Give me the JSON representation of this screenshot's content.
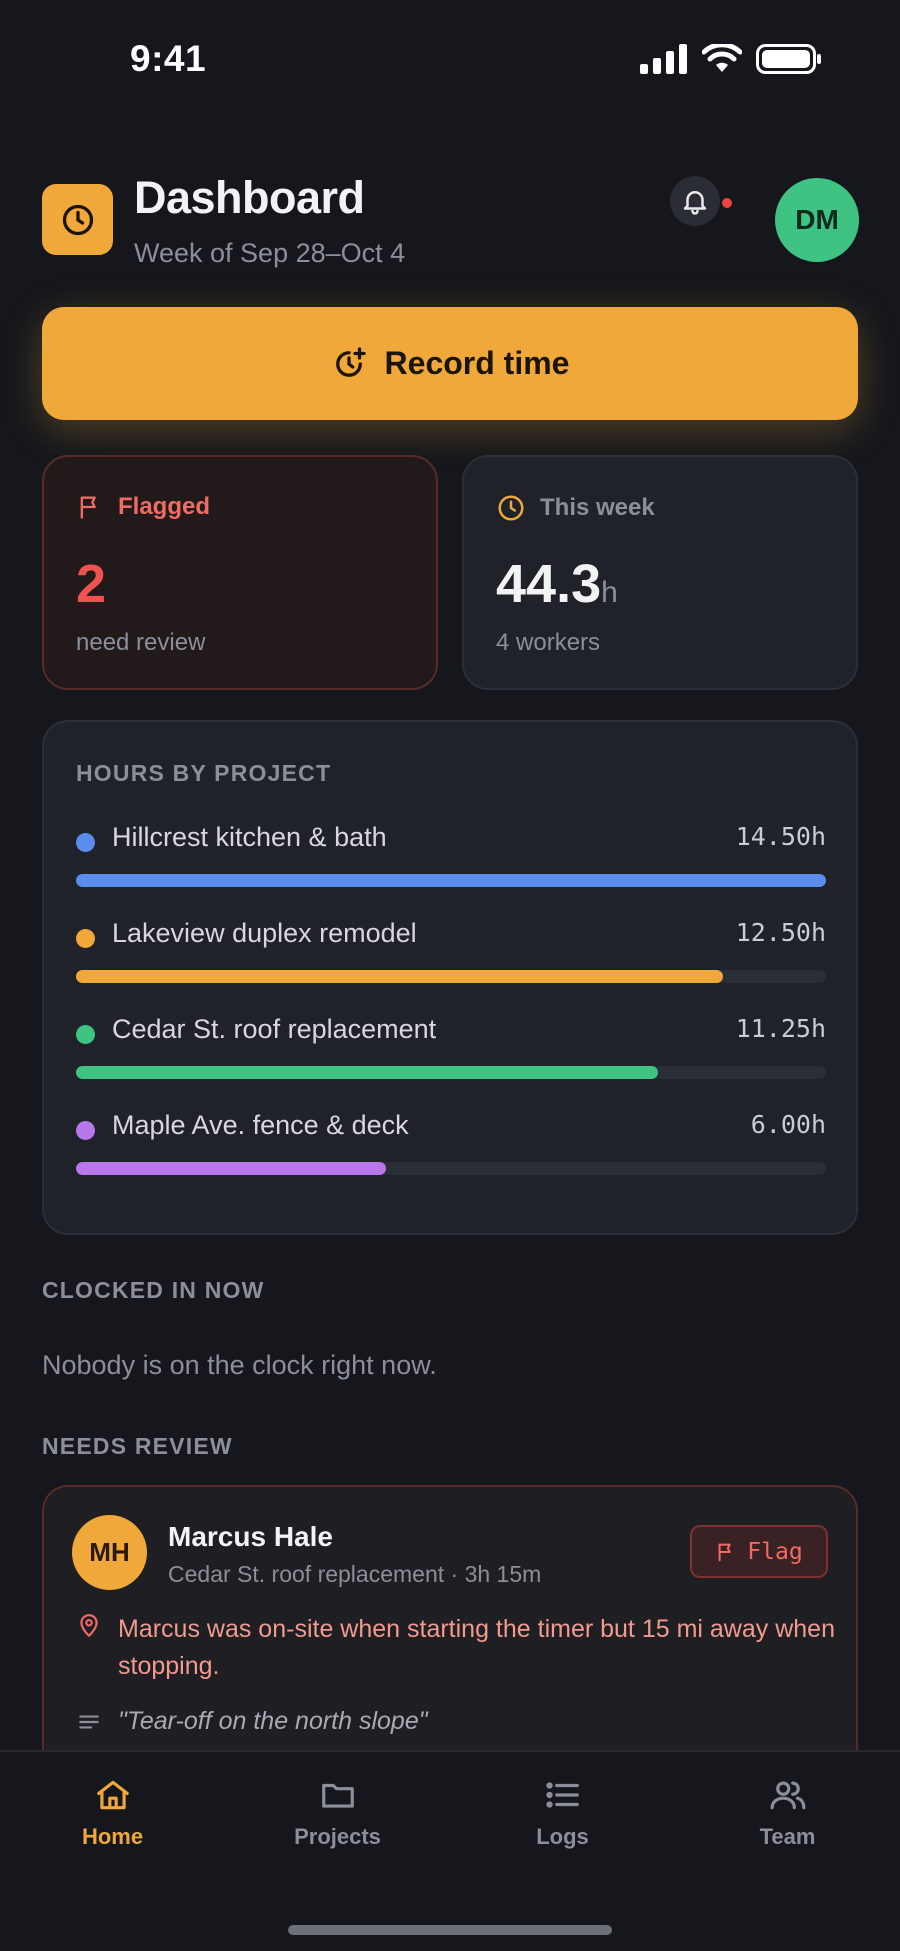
{
  "status_bar": {
    "time": "9:41"
  },
  "header": {
    "title": "Dashboard",
    "subtitle": "Week of Sep 28–Oct 4",
    "avatar_initials": "DM"
  },
  "record_button": {
    "label": "Record time"
  },
  "flagged_card": {
    "label": "Flagged",
    "value": "2",
    "note": "need review"
  },
  "week_card": {
    "label": "This week",
    "value": "44.3",
    "unit": "h",
    "note": "4 workers"
  },
  "hours_by_project": {
    "title": "HOURS BY PROJECT",
    "projects": [
      {
        "name": "Hillcrest kitchen & bath",
        "hours": "14.50h",
        "value": 14.5,
        "color": "#5b8def"
      },
      {
        "name": "Lakeview duplex remodel",
        "hours": "12.50h",
        "value": 12.5,
        "color": "#f0a83a"
      },
      {
        "name": "Cedar St. roof replacement",
        "hours": "11.25h",
        "value": 11.25,
        "color": "#3fc383"
      },
      {
        "name": "Maple Ave. fence & deck",
        "hours": "6.00h",
        "value": 6.0,
        "color": "#b877ea"
      }
    ]
  },
  "clocked_in": {
    "title": "CLOCKED IN NOW",
    "empty_text": "Nobody is on the clock right now."
  },
  "needs_review": {
    "title": "NEEDS REVIEW",
    "item": {
      "initials": "MH",
      "name": "Marcus Hale",
      "meta": "Cedar St. roof replacement · 3h 15m",
      "flag_label": "Flag",
      "warning": "Marcus was on-site when starting the timer but 15 mi away when stopping.",
      "note": "\"Tear-off on the north slope\""
    }
  },
  "tabs": [
    {
      "label": "Home",
      "icon": "home-icon",
      "active": true
    },
    {
      "label": "Projects",
      "icon": "folder-icon",
      "active": false
    },
    {
      "label": "Logs",
      "icon": "list-icon",
      "active": false
    },
    {
      "label": "Team",
      "icon": "users-icon",
      "active": false
    }
  ],
  "colors": {
    "accent": "#f0a83a",
    "danger": "#ef4444",
    "success": "#3fc383",
    "background": "#15171c"
  }
}
